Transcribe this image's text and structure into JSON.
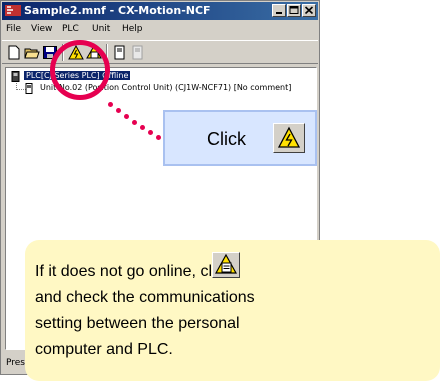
{
  "window": {
    "title": "Sample2.mnf - CX-Motion-NCF",
    "minimize_icon": "minimize-icon",
    "maximize_icon": "maximize-icon",
    "close_icon": "close-icon"
  },
  "menu": {
    "file": "File",
    "view": "View",
    "plc": "PLC",
    "unit": "Unit",
    "help": "Help"
  },
  "toolbar": {
    "icons": [
      "new-icon",
      "open-icon",
      "save-icon",
      "work-online-icon",
      "communication-settings-icon",
      "unit-icon",
      "unit-disabled-icon"
    ]
  },
  "tree": {
    "plc_label": "PLC[CJ Series PLC] Offline",
    "unit_label": "Unit No.02 (Position Control Unit) (CJ1W-NCF71) [No comment]"
  },
  "status": {
    "text": "Press"
  },
  "callout": {
    "label": "Click"
  },
  "note": {
    "line1": "If it does not go online, click",
    "line2": "and check the communications",
    "line3": "setting between the personal",
    "line4": "computer and PLC."
  },
  "colors": {
    "highlight": "#e60050",
    "callout_bg": "#d8e6ff",
    "note_bg": "#fff8c4",
    "titlebar": "#0a246a"
  }
}
